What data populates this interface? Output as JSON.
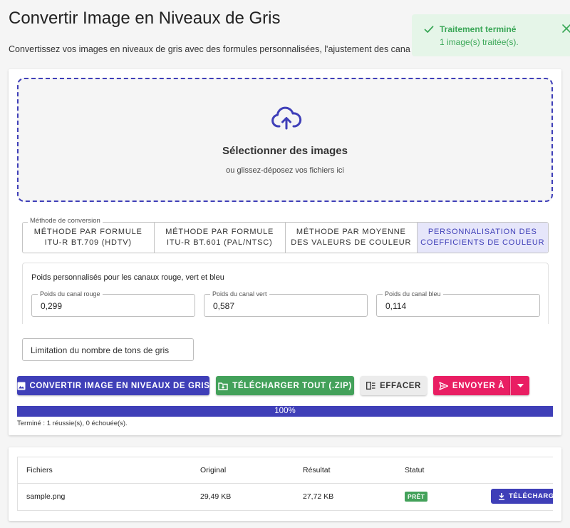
{
  "page": {
    "title": "Convertir Image en Niveaux de Gris",
    "subtitle": "Convertissez vos images en niveaux de gris avec des formules personnalisées, l'ajustement des cana"
  },
  "toast": {
    "title": "Traitement terminé",
    "message": "1 image(s) traitée(s).",
    "color": "#3aa757",
    "icon": "check-icon",
    "close_icon": "close-icon"
  },
  "dropzone": {
    "title": "Sélectionner des images",
    "subtitle": "ou glissez-déposez vos fichiers ici",
    "icon": "cloud-upload-icon"
  },
  "conversion": {
    "legend": "Méthode de conversion",
    "methods": [
      {
        "line1": "MÉTHODE PAR FORMULE",
        "line2": "ITU-R BT.709 (HDTV)"
      },
      {
        "line1": "MÉTHODE PAR FORMULE",
        "line2": "ITU-R BT.601 (PAL/NTSC)"
      },
      {
        "line1": "MÉTHODE PAR MOYENNE",
        "line2": "DES VALEURS DE COULEUR"
      },
      {
        "line1": "PERSONNALISATION DES",
        "line2": "COEFFICIENTS DE COULEUR"
      }
    ],
    "selected_index": 3
  },
  "weights": {
    "title": "Poids personnalisés pour les canaux rouge, vert et bleu",
    "red": {
      "label": "Poids du canal rouge",
      "value": "0,299"
    },
    "green": {
      "label": "Poids du canal vert",
      "value": "0,587"
    },
    "blue": {
      "label": "Poids du canal bleu",
      "value": "0,114"
    }
  },
  "limit": {
    "label": "Limitation du nombre de tons de gris"
  },
  "actions": {
    "convert": "CONVERTIR IMAGE EN NIVEAUX DE GRIS",
    "zip": "TÉLÉCHARGER TOUT (.ZIP)",
    "clear": "EFFACER",
    "send": "ENVOYER À"
  },
  "progress": {
    "percent_value": 100,
    "label": "100%",
    "status": "Terminé : 1 réussie(s), 0 échouée(s)."
  },
  "table": {
    "headers": {
      "files": "Fichiers",
      "original": "Original",
      "result": "Résultat",
      "status": "Statut"
    },
    "rows": [
      {
        "file": "sample.png",
        "original": "29,49 KB",
        "result": "27,72 KB",
        "status": "PRÊT",
        "action": "TÉLÉCHARGER"
      }
    ]
  },
  "colors": {
    "primary": "#3f3fb8",
    "success": "#43a15a",
    "send": "#e91e63",
    "toast_bg": "#e5f5e8"
  }
}
